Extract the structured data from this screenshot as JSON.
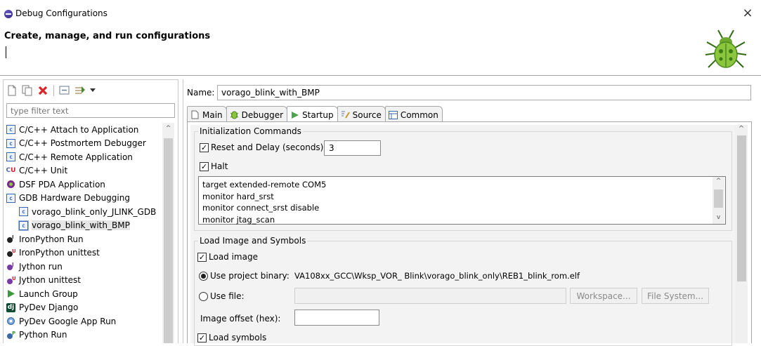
{
  "window": {
    "title": "Debug Configurations",
    "close_glyph": "×"
  },
  "header": {
    "title": "Create, manage, and run configurations",
    "message": ""
  },
  "left": {
    "filter_placeholder": "type filter text",
    "tree": [
      {
        "label": "C/C++ Attach to Application",
        "icon": "c-icon",
        "child": false
      },
      {
        "label": "C/C++ Postmortem Debugger",
        "icon": "c-icon",
        "child": false
      },
      {
        "label": "C/C++ Remote Application",
        "icon": "c-icon",
        "child": false
      },
      {
        "label": "C/C++ Unit",
        "icon": "cu-icon",
        "child": false
      },
      {
        "label": "DSF PDA Application",
        "icon": "dsf-icon",
        "child": false
      },
      {
        "label": "GDB Hardware Debugging",
        "icon": "c-icon",
        "child": false
      },
      {
        "label": "vorago_blink_only_JLINK_GDB",
        "icon": "c-icon",
        "child": true
      },
      {
        "label": "vorago_blink_with_BMP",
        "icon": "c-icon",
        "child": true,
        "selected": true
      },
      {
        "label": "IronPython Run",
        "icon": "python-icon",
        "child": false
      },
      {
        "label": "IronPython unittest",
        "icon": "python-icon",
        "child": false
      },
      {
        "label": "Jython run",
        "icon": "python-icon",
        "child": false
      },
      {
        "label": "Jython unittest",
        "icon": "python-icon",
        "child": false
      },
      {
        "label": "Launch Group",
        "icon": "launch-icon",
        "child": false
      },
      {
        "label": "PyDev Django",
        "icon": "django-icon",
        "child": false
      },
      {
        "label": "PyDev Google App Run",
        "icon": "gae-icon",
        "child": false
      },
      {
        "label": "Python Run",
        "icon": "python-icon",
        "child": false
      }
    ]
  },
  "right": {
    "name_label": "Name:",
    "name_value": "vorago_blink_with_BMP",
    "tabs": [
      {
        "label": "Main",
        "icon": "main-icon"
      },
      {
        "label": "Debugger",
        "icon": "debugger-icon"
      },
      {
        "label": "Startup",
        "icon": "startup-icon",
        "active": true
      },
      {
        "label": "Source",
        "icon": "source-icon"
      },
      {
        "label": "Common",
        "icon": "common-icon"
      }
    ],
    "init": {
      "title": "Initialization Commands",
      "reset_label": "Reset and Delay (seconds):",
      "reset_checked": true,
      "reset_value": "3",
      "halt_label": "Halt",
      "halt_checked": true,
      "commands": [
        "target extended-remote COM5",
        "monitor hard_srst",
        "monitor connect_srst disable",
        "monitor jtag_scan"
      ]
    },
    "load": {
      "title": "Load Image and Symbols",
      "load_image_label": "Load image",
      "load_image_checked": true,
      "use_project_binary_label": "Use project binary:",
      "project_binary_path": "VA108xx_GCC\\Wksp_VOR_ Blink\\vorago_blink_only\\REB1_blink_rom.elf",
      "use_file_label": "Use file:",
      "workspace_button": "Workspace...",
      "filesystem_button": "File System...",
      "image_offset_label": "Image offset (hex):",
      "load_symbols_label": "Load symbols",
      "load_symbols_checked": true
    }
  },
  "colors": {
    "selected_bg": "#e6e6e6",
    "panel_bg": "#f3f3f3",
    "c_icon": "#3b63b5"
  }
}
